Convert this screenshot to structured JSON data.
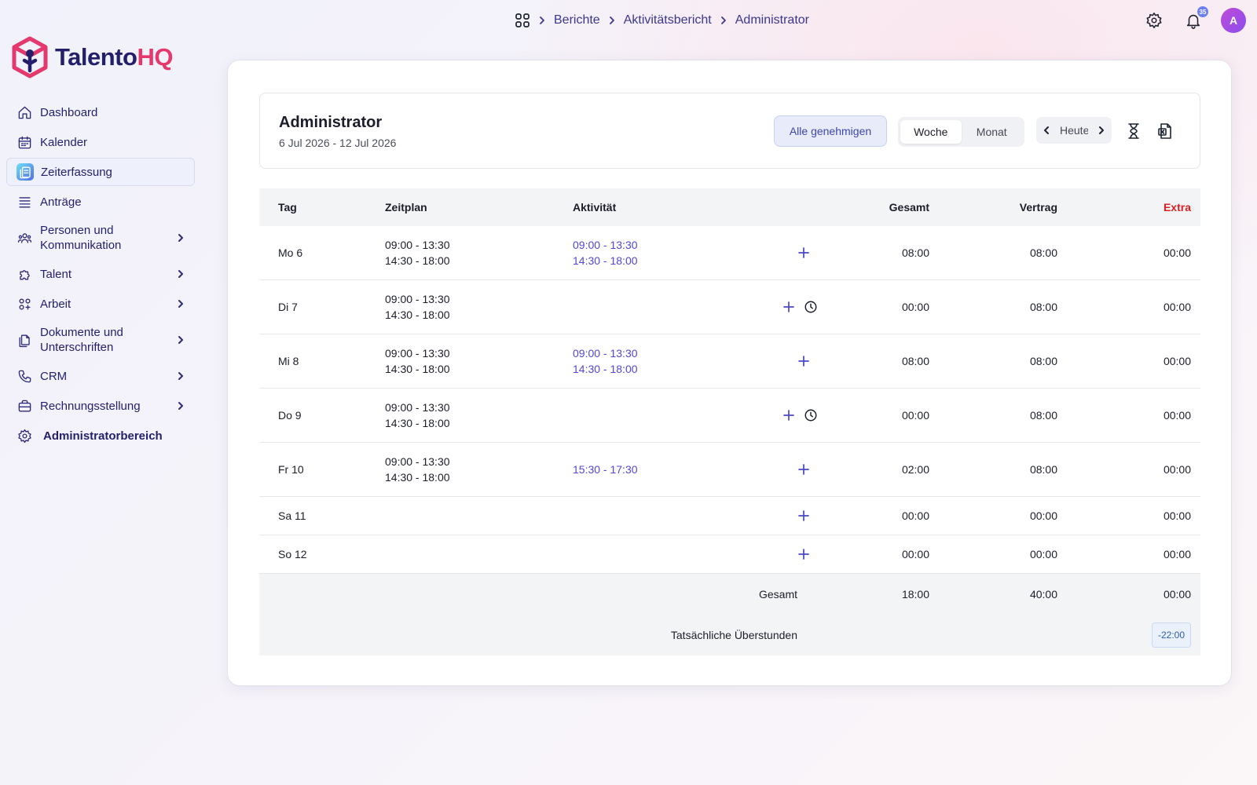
{
  "brand": {
    "name_part1": "Talento",
    "name_part2": "HQ"
  },
  "breadcrumb": [
    "Berichte",
    "Aktivitätsbericht",
    "Administrator"
  ],
  "topbar": {
    "notifications_count": "35",
    "avatar_initial": "A"
  },
  "sidebar": {
    "items": [
      {
        "label": "Dashboard"
      },
      {
        "label": "Kalender"
      },
      {
        "label": "Zeiterfassung"
      },
      {
        "label": "Anträge"
      },
      {
        "label": "Personen und Kommunikation"
      },
      {
        "label": "Talent"
      },
      {
        "label": "Arbeit"
      },
      {
        "label": "Dokumente und Unterschriften"
      },
      {
        "label": "CRM"
      },
      {
        "label": "Rechnungsstellung"
      },
      {
        "label": "Administratorbereich"
      }
    ]
  },
  "report": {
    "title": "Administrator",
    "range": "6 Jul 2026 - 12 Jul 2026",
    "approve_all": "Alle genehmigen",
    "view_week": "Woche",
    "view_month": "Monat",
    "today": "Heute"
  },
  "table": {
    "headers": {
      "day": "Tag",
      "schedule": "Zeitplan",
      "activity": "Aktivität",
      "total": "Gesamt",
      "contract": "Vertrag",
      "extra": "Extra"
    },
    "rows": [
      {
        "day": "Mo 6",
        "schedule": [
          "09:00 - 13:30",
          "14:30 - 18:00"
        ],
        "activity": [
          "09:00 - 13:30",
          "14:30 - 18:00"
        ],
        "total": "08:00",
        "contract": "08:00",
        "extra": "00:00"
      },
      {
        "day": "Di 7",
        "schedule": [
          "09:00 - 13:30",
          "14:30 - 18:00"
        ],
        "activity": [],
        "total": "00:00",
        "contract": "08:00",
        "extra": "00:00"
      },
      {
        "day": "Mi 8",
        "schedule": [
          "09:00 - 13:30",
          "14:30 - 18:00"
        ],
        "activity": [
          "09:00 - 13:30",
          "14:30 - 18:00"
        ],
        "total": "08:00",
        "contract": "08:00",
        "extra": "00:00"
      },
      {
        "day": "Do 9",
        "schedule": [
          "09:00 - 13:30",
          "14:30 - 18:00"
        ],
        "activity": [],
        "total": "00:00",
        "contract": "08:00",
        "extra": "00:00"
      },
      {
        "day": "Fr 10",
        "schedule": [
          "09:00 - 13:30",
          "14:30 - 18:00"
        ],
        "activity": [
          "15:30 - 17:30"
        ],
        "total": "02:00",
        "contract": "08:00",
        "extra": "00:00"
      },
      {
        "day": "Sa 11",
        "schedule": [],
        "activity": [],
        "total": "00:00",
        "contract": "00:00",
        "extra": "00:00"
      },
      {
        "day": "So 12",
        "schedule": [],
        "activity": [],
        "total": "00:00",
        "contract": "00:00",
        "extra": "00:00"
      }
    ],
    "footer": {
      "total_label": "Gesamt",
      "total": "18:00",
      "contract": "40:00",
      "extra": "00:00",
      "overtime_label": "Tatsächliche Überstunden",
      "overtime": "-22:00"
    }
  },
  "colors": {
    "brand_navy": "#231f6b",
    "brand_pink": "#e5386d",
    "activity": "#5247d6",
    "extra_header": "#d92121"
  }
}
